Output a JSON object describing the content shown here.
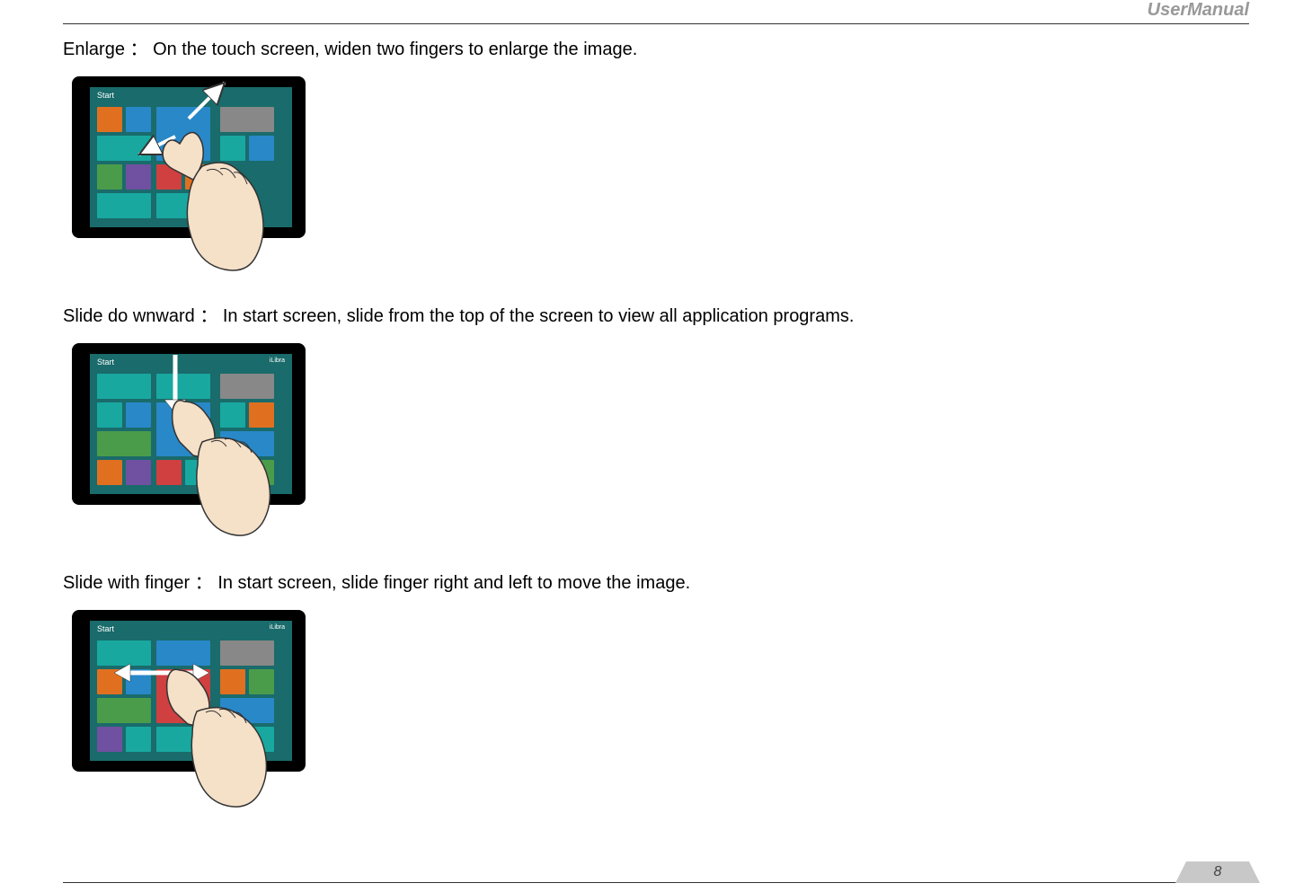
{
  "header": {
    "title": "UserManual"
  },
  "sections": [
    {
      "label": "Enlarge",
      "separator": "：",
      "description": "On the touch screen, widen two fingers to enlarge the image."
    },
    {
      "label": "Slide do wnward",
      "separator": "：",
      "description": "In start screen, slide from the top of the screen to view all application programs."
    },
    {
      "label": "Slide with finger",
      "separator": "：",
      "description": "In start screen, slide finger right and left to move the image."
    }
  ],
  "screen": {
    "start_label": "Start",
    "user_label": "iLibra"
  },
  "footer": {
    "page_number": "8"
  }
}
